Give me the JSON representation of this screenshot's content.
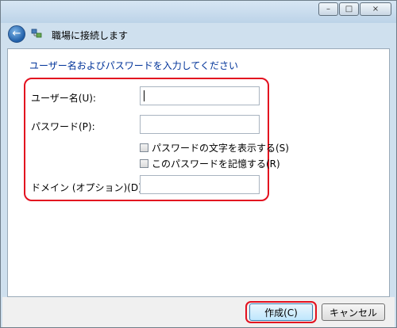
{
  "header": {
    "title": "職場に接続します"
  },
  "form": {
    "instruction": "ユーザー名およびパスワードを入力してください",
    "username_label": "ユーザー名(U):",
    "password_label": "パスワード(P):",
    "show_password_label": "パスワードの文字を表示する(S)",
    "remember_password_label": "このパスワードを記憶する(R)",
    "domain_label": "ドメイン (オプション)(D):",
    "username_value": "",
    "password_value": "",
    "domain_value": ""
  },
  "footer": {
    "create_label": "作成(C)",
    "cancel_label": "キャンセル"
  },
  "window_buttons": {
    "minimize": "–",
    "maximize": "□",
    "close": "×"
  },
  "icons": {
    "back": "back-arrow-icon",
    "network": "network-icon"
  },
  "colors": {
    "highlight": "#e3101f",
    "instruction_text": "#003399"
  }
}
